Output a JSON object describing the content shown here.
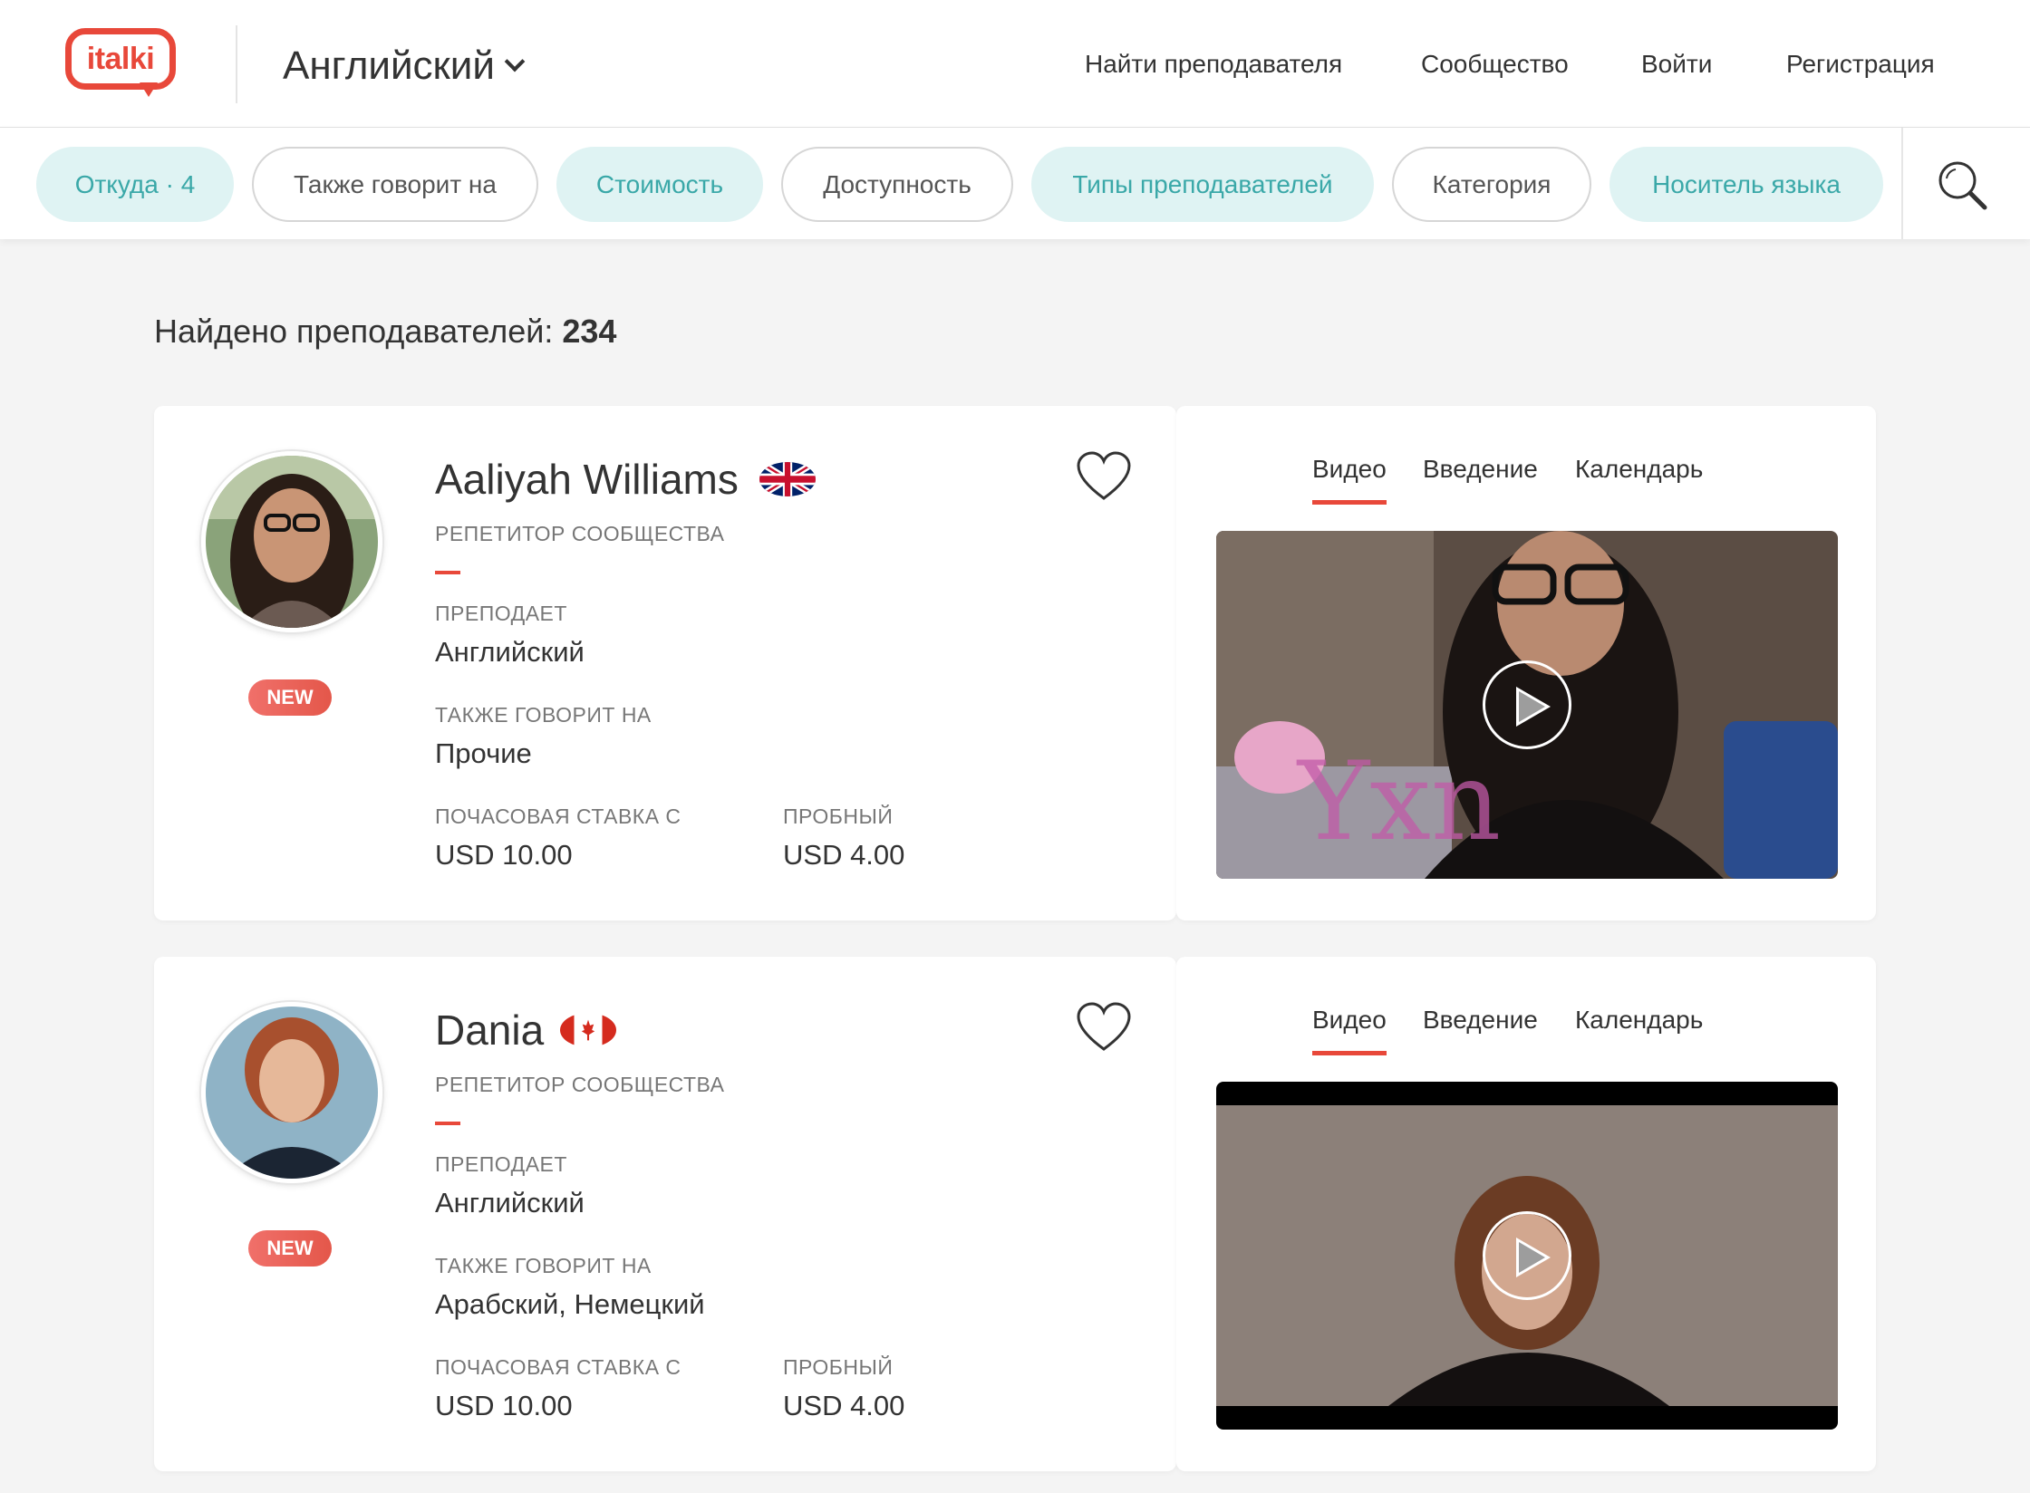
{
  "header": {
    "logo_text": "italki",
    "language": "Английский",
    "nav": [
      "Найти преподавателя",
      "Сообщество",
      "Войти",
      "Регистрация"
    ]
  },
  "filters": [
    {
      "label": "Откуда · 4",
      "active": true
    },
    {
      "label": "Также говорит на",
      "active": false
    },
    {
      "label": "Стоимость",
      "active": true
    },
    {
      "label": "Доступность",
      "active": false
    },
    {
      "label": "Типы преподавателей",
      "active": true
    },
    {
      "label": "Категория",
      "active": false
    },
    {
      "label": "Носитель языка",
      "active": true
    }
  ],
  "results": {
    "label": "Найдено преподавателей:",
    "count": "234"
  },
  "labels": {
    "teaches": "ПРЕПОДАЕТ",
    "also_speaks": "ТАКЖЕ ГОВОРИТ НА",
    "hourly": "ПОЧАСОВАЯ СТАВКА С",
    "trial": "ПРОБНЫЙ",
    "new": "NEW"
  },
  "tabs": [
    "Видео",
    "Введение",
    "Календарь"
  ],
  "teachers": [
    {
      "name": "Aaliyah Williams",
      "country_flag": "uk-flag",
      "type": "РЕПЕТИТОР СООБЩЕСТВА",
      "teaches": "Английский",
      "also_speaks": "Прочие",
      "hourly": "USD 10.00",
      "trial": "USD 4.00"
    },
    {
      "name": "Dania",
      "country_flag": "canada-flag",
      "type": "РЕПЕТИТОР СООБЩЕСТВА",
      "teaches": "Английский",
      "also_speaks": "Арабский, Немецкий",
      "hourly": "USD 10.00",
      "trial": "USD 4.00"
    }
  ],
  "colors": {
    "accent": "#e8483a",
    "teal": "#3aa8a8",
    "teal_bg": "#dff3f3"
  }
}
